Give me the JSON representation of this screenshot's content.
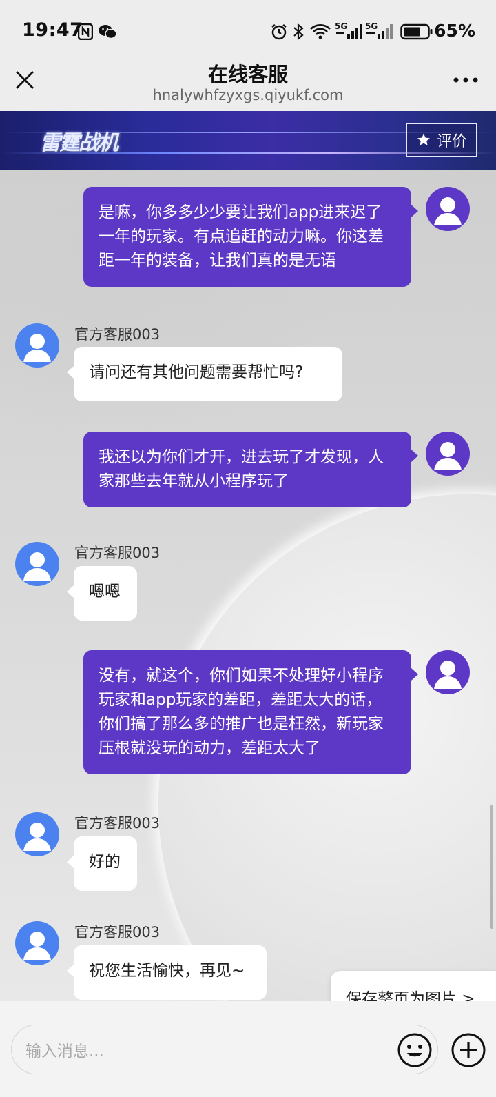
{
  "status_bar": {
    "time": "19:47",
    "battery_percent": "65%",
    "signal_1": "5G",
    "signal_2": "5G",
    "icons": [
      "nfc-icon",
      "wechat-icon",
      "alarm-icon",
      "bluetooth-icon",
      "wifi-icon",
      "signal-icon",
      "battery-icon"
    ]
  },
  "nav": {
    "title": "在线客服",
    "subtitle": "hnalywhfzyxgs.qiyukf.com"
  },
  "banner": {
    "logo_text": "雷霆战机",
    "rate_label": "评价"
  },
  "messages": [
    {
      "role": "user",
      "text": "是嘛，你多多少少要让我们app进来迟了一年的玩家。有点追赶的动力嘛。你这差距一年的装备，让我们真的是无语"
    },
    {
      "role": "agent",
      "sender": "官方客服003",
      "text": "请问还有其他问题需要帮忙吗?"
    },
    {
      "role": "user",
      "text": "我还以为你们才开，进去玩了才发现，人家那些去年就从小程序玩了"
    },
    {
      "role": "agent",
      "sender": "官方客服003",
      "text": "嗯嗯"
    },
    {
      "role": "user",
      "text": "没有，就这个，你们如果不处理好小程序玩家和app玩家的差距，差距太大的话，你们搞了那么多的推广也是枉然，新玩家压根就没玩的动力，差距太大了"
    },
    {
      "role": "agent",
      "sender": "官方客服003",
      "text": "好的"
    },
    {
      "role": "agent",
      "sender": "官方客服003",
      "text": "祝您生活愉快，再见~"
    }
  ],
  "save_page_label": "保存整页为图片 >",
  "input": {
    "placeholder": "输入消息..."
  },
  "colors": {
    "user_bubble": "#5d37c5",
    "agent_avatar": "#4b82f0",
    "agent_bubble": "#ffffff"
  }
}
